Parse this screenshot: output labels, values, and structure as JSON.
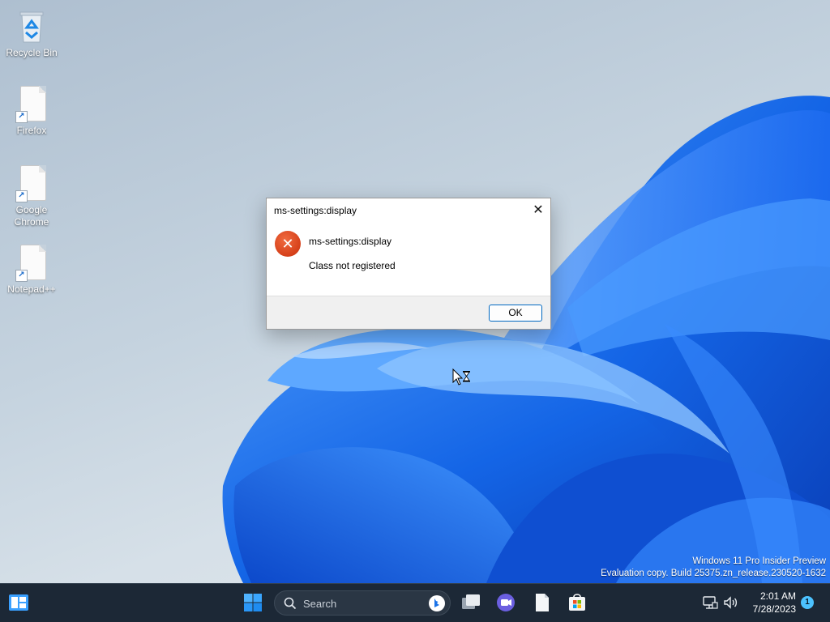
{
  "desktop": {
    "icons": [
      {
        "label": "Recycle Bin",
        "icon": "recycle-bin-icon"
      },
      {
        "label": "Firefox",
        "icon": "file-shortcut-icon"
      },
      {
        "label": "Google Chrome",
        "icon": "file-shortcut-icon"
      },
      {
        "label": "Notepad++",
        "icon": "file-shortcut-icon"
      }
    ],
    "watermark": {
      "line1": "Windows 11 Pro Insider Preview",
      "line2": "Evaluation copy. Build 25375.zn_release.230520-1632"
    }
  },
  "dialog": {
    "title": "ms-settings:display",
    "close_glyph": "✕",
    "icon": "error-icon",
    "heading": "ms-settings:display",
    "message": "Class not registered",
    "ok_label": "OK"
  },
  "taskbar": {
    "search_label": "Search",
    "clock_time": "2:01 AM",
    "clock_date": "7/28/2023",
    "notification_count": "1",
    "accent": "#0078d4",
    "background": "#1c2836"
  }
}
